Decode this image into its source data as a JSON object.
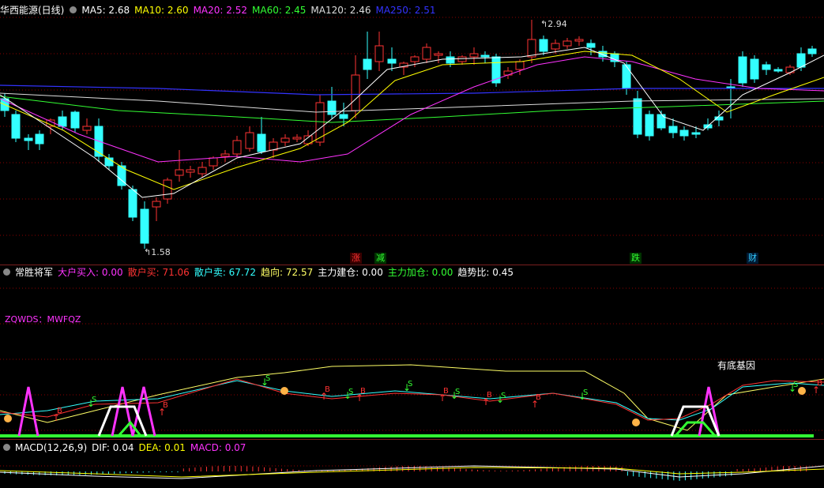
{
  "title_bar": {
    "stock_name": "华西能源(日线)",
    "ma": [
      {
        "label": "MA5: 2.68",
        "color": "#ffffff"
      },
      {
        "label": "MA10: 2.60",
        "color": "#ffff00"
      },
      {
        "label": "MA20: 2.52",
        "color": "#ff33ff"
      },
      {
        "label": "MA60: 2.45",
        "color": "#33ff33"
      },
      {
        "label": "MA120: 2.46",
        "color": "#dddddd"
      },
      {
        "label": "MA250: 2.51",
        "color": "#3333ff"
      }
    ],
    "high_label": "2.94",
    "low_label": "1.58"
  },
  "events": {
    "rise": "涨",
    "reduce": "减",
    "fall": "跌",
    "finance": "财"
  },
  "indicator": {
    "name": "常胜将军",
    "items": [
      {
        "label": "大户买入: 0.00",
        "color": "#ff33ff"
      },
      {
        "label": "散户买: 71.06",
        "color": "#ff3333"
      },
      {
        "label": "散户卖: 67.72",
        "color": "#33ffff"
      },
      {
        "label": "趋向: 72.57",
        "color": "#ffff66"
      },
      {
        "label": "主力建仓: 0.00",
        "color": "#ffffff"
      },
      {
        "label": "主力加仓: 0.00",
        "color": "#33ff33"
      },
      {
        "label": "趋势比: 0.45",
        "color": "#ffffff"
      }
    ],
    "zqwds": "ZQWDS：MWFQZ",
    "gene": "有底基因",
    "buy_letter": "B",
    "sell_letter": "S"
  },
  "macd": {
    "name": "MACD(12,26,9)",
    "dif": "DIF: 0.04",
    "dea": "DEA: 0.01",
    "macd": "MACD: 0.07"
  },
  "colors": {
    "up": "#ff3333",
    "down": "#33ffff",
    "grid": "#8b0000",
    "ma5": "#ffffff",
    "ma10": "#ffff00",
    "ma20": "#ff33ff",
    "ma60": "#33ff33",
    "ma120": "#dddddd",
    "ma250": "#3333ff"
  }
}
